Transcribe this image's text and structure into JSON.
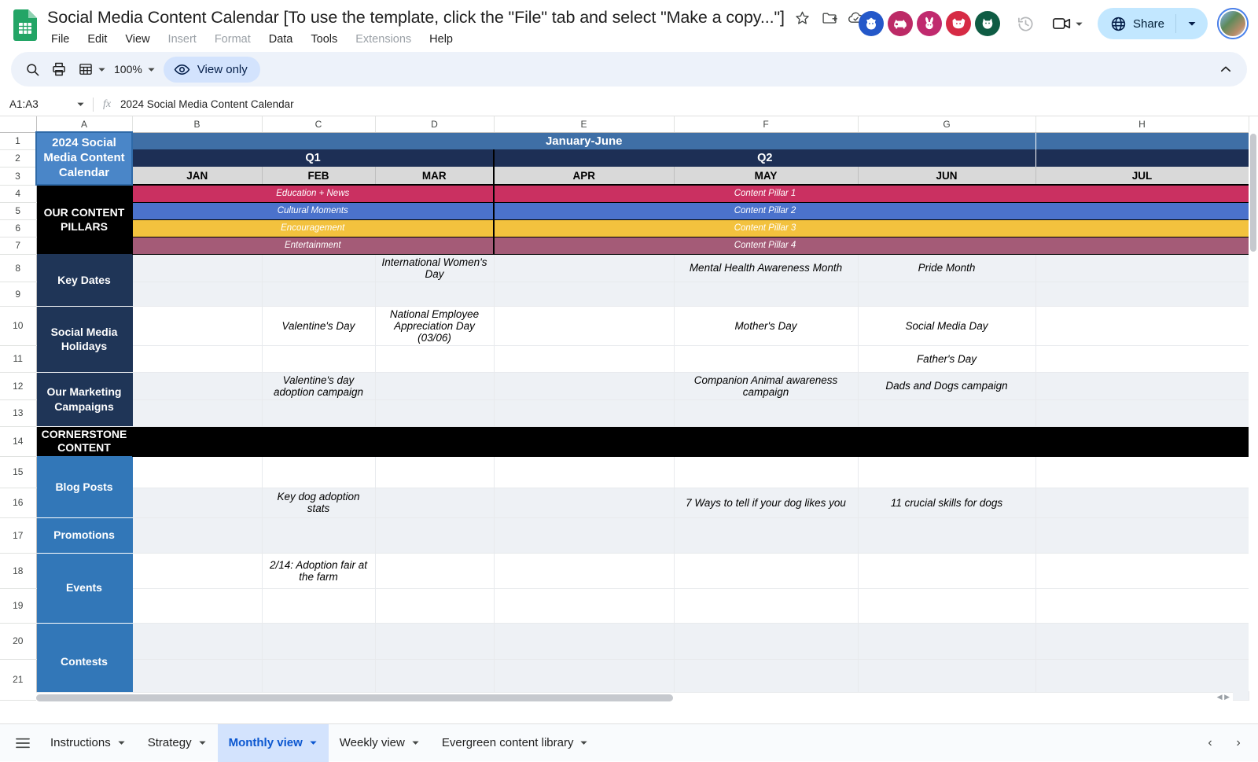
{
  "app": {
    "doc_title": "Social Media Content Calendar [To use the template, click the \"File\" tab and select \"Make a copy...\"]",
    "menus": [
      "File",
      "Edit",
      "View",
      "Insert",
      "Format",
      "Data",
      "Tools",
      "Extensions",
      "Help"
    ],
    "dim_menus": [
      "Insert",
      "Format",
      "Extensions"
    ]
  },
  "toolbar": {
    "zoom": "100%",
    "view_only_label": "View only"
  },
  "share": {
    "label": "Share"
  },
  "collaborators": [
    {
      "name": "wolf-avatar",
      "color": "#2458c9",
      "glyph": "🐺"
    },
    {
      "name": "pig-avatar",
      "color": "#bc2a66",
      "glyph": "🐖"
    },
    {
      "name": "rabbit-avatar",
      "color": "#c02a6e",
      "glyph": "🐇"
    },
    {
      "name": "dog-avatar",
      "color": "#d62b45",
      "glyph": "🐕"
    },
    {
      "name": "cat-avatar",
      "color": "#0f5c44",
      "glyph": "🐈"
    }
  ],
  "formula_bar": {
    "name_box": "A1:A3",
    "formula": "2024 Social Media Content Calendar"
  },
  "grid": {
    "columns": [
      "A",
      "B",
      "C",
      "D",
      "E",
      "F",
      "G",
      "H"
    ],
    "rows": [
      "1",
      "2",
      "3",
      "4",
      "5",
      "6",
      "7",
      "8",
      "9",
      "10",
      "11",
      "12",
      "13",
      "14",
      "15",
      "16",
      "17",
      "18",
      "19",
      "20",
      "21"
    ]
  },
  "sheet": {
    "title_cell": "2024 Social Media Content Calendar",
    "half_label": "January-June",
    "quarters": [
      "Q1",
      "Q2"
    ],
    "months": [
      "JAN",
      "FEB",
      "MAR",
      "APR",
      "MAY",
      "JUN",
      "JUL"
    ],
    "section_labels": {
      "pillars": "OUR CONTENT PILLARS",
      "key_dates": "Key Dates",
      "holidays": "Social Media Holidays",
      "campaigns": "Our Marketing Campaigns",
      "cornerstone": "CORNERSTONE CONTENT",
      "blog": "Blog Posts",
      "promotions": "Promotions",
      "events": "Events",
      "contests": "Contests"
    },
    "pillars": [
      {
        "q1_label": "Education + News",
        "q2_label": "Content Pillar 1",
        "color": "#ca3061"
      },
      {
        "q1_label": "Cultural Moments",
        "q2_label": "Content Pillar 2",
        "color": "#4b72cc"
      },
      {
        "q1_label": "Encouragement",
        "q2_label": "Content Pillar 3",
        "color": "#f3c23e"
      },
      {
        "q1_label": "Entertainment",
        "q2_label": "Content Pillar 4",
        "color": "#a45b77"
      }
    ],
    "cells": {
      "key_dates": {
        "mar": "International Women's Day",
        "may": "Mental Health Awareness Month",
        "jun": "Pride Month"
      },
      "holidays": {
        "feb": "Valentine's Day",
        "mar": "National Employee Appreciation Day (03/06)",
        "may": "Mother's Day",
        "jun_r10": "Social Media Day",
        "jun_r11": "Father's Day"
      },
      "campaigns": {
        "feb": "Valentine's day adoption campaign",
        "may": "Companion Animal awareness campaign",
        "jun": "Dads and Dogs campaign"
      },
      "blog": {
        "feb": "Key dog adoption stats",
        "may": "7 Ways to tell if your dog likes you",
        "jun": "11 crucial skills for dogs"
      },
      "events": {
        "feb": "2/14: Adoption fair at the farm"
      }
    }
  },
  "sheet_tabs": {
    "items": [
      {
        "label": "Instructions",
        "active": false
      },
      {
        "label": "Strategy",
        "active": false
      },
      {
        "label": "Monthly view",
        "active": true
      },
      {
        "label": "Weekly view",
        "active": false
      },
      {
        "label": "Evergreen content library",
        "active": false
      }
    ]
  }
}
